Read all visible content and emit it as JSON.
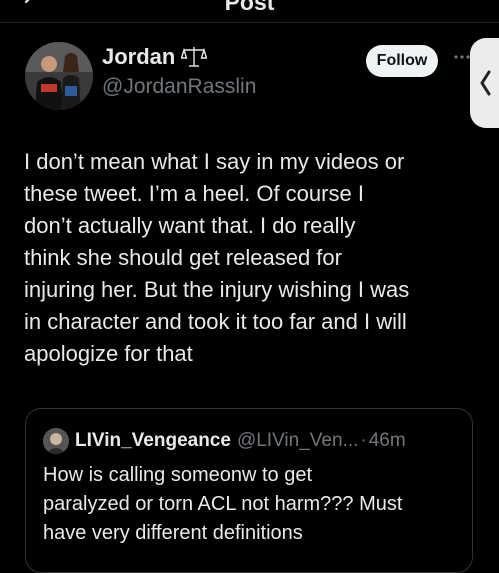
{
  "header": {
    "title": "Post"
  },
  "author": {
    "display_name": "Jordan",
    "handle": "@JordanRasslin",
    "follow_label": "Follow",
    "badge_icon": "scale-icon"
  },
  "tweet": {
    "text": "I don’t mean what I say in my videos or\nthese tweet. I’m a heel. Of course I\ndon’t actually want that. I do really\nthink she should get released for\ninjuring her. But the injury wishing I was\nin character and took it too far and I will\napologize for that"
  },
  "quote": {
    "display_name": "LIVin_Vengeance",
    "handle": "@LIVin_Ven...",
    "separator": "·",
    "time": "46m",
    "text": "How is calling someonw to get\nparalyzed or torn ACL not harm??? Must\nhave very different definitions"
  },
  "colors": {
    "background": "#000000",
    "text": "#e7e9ea",
    "secondary": "#71767b",
    "border": "#2f3336",
    "follow_bg": "#eff3f4"
  }
}
